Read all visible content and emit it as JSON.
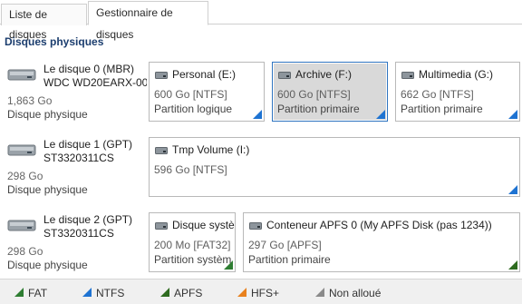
{
  "tabs": [
    {
      "label": "Liste de disques",
      "active": false
    },
    {
      "label": "Gestionnaire de disques",
      "active": true
    }
  ],
  "section_title": "Disques physiques",
  "icons": {
    "disk": "hard-disk-icon",
    "partition": "drive-icon",
    "corner": "triangle-corner-icon"
  },
  "colors": {
    "FAT": "#2e7d32",
    "NTFS": "#1e73d2",
    "APFS": "#2e6b1f",
    "HFS": "#e8811e",
    "unallocated": "#8a8a8a",
    "selected_border": "#2f74c0"
  },
  "disks": [
    {
      "name1": "Le disque 0 (MBR)",
      "name2": "WDC WD20EARX-00",
      "size": "1,863 Go",
      "kind": "Disque physique",
      "partitions": [
        {
          "title": "Personal (E:)",
          "fs": "600 Go [NTFS]",
          "kind": "Partition logique",
          "type": "NTFS"
        },
        {
          "title": "Archive (F:)",
          "fs": "600 Go [NTFS]",
          "kind": "Partition primaire",
          "type": "NTFS",
          "selected": true
        },
        {
          "title": "Multimedia (G:)",
          "fs": "662 Go [NTFS]",
          "kind": "Partition primaire",
          "type": "NTFS"
        }
      ]
    },
    {
      "name1": "Le disque 1 (GPT)",
      "name2": "ST3320311CS",
      "size": "298 Go",
      "kind": "Disque physique",
      "partitions": [
        {
          "title": "Tmp Volume (I:)",
          "fs": "596 Go [NTFS]",
          "kind": "",
          "type": "NTFS"
        }
      ]
    },
    {
      "name1": "Le disque 2 (GPT)",
      "name2": "ST3320311CS",
      "size": "298 Go",
      "kind": "Disque physique",
      "partitions": [
        {
          "title": "Disque systè",
          "fs": "200 Mo [FAT32]",
          "kind": "Partition systèm",
          "type": "FAT"
        },
        {
          "title": "Conteneur APFS 0 (My APFS Disk (pas 1234))",
          "fs": "297 Go [APFS]",
          "kind": "Partition primaire",
          "type": "APFS"
        }
      ]
    }
  ],
  "legend": [
    {
      "label": "FAT",
      "type": "FAT"
    },
    {
      "label": "NTFS",
      "type": "NTFS"
    },
    {
      "label": "APFS",
      "type": "APFS"
    },
    {
      "label": "HFS+",
      "type": "HFS"
    },
    {
      "label": "Non alloué",
      "type": "unallocated"
    }
  ]
}
